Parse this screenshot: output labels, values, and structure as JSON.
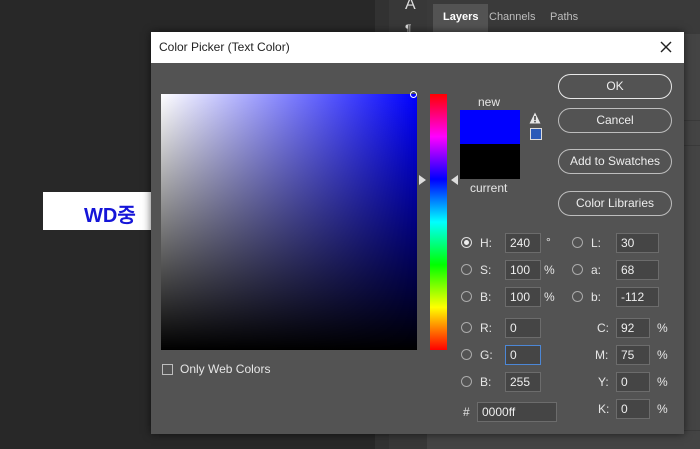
{
  "background": {
    "canvas_text": "WD중",
    "panel_tabs": [
      "Layers",
      "Channels",
      "Paths"
    ],
    "tool_glyph": "A",
    "tool_glyph2": "¶"
  },
  "dialog": {
    "title": "Color Picker (Text Color)",
    "close_icon": "close-icon",
    "new_label": "new",
    "current_label": "current",
    "new_color": "#0000ff",
    "current_color": "#000000",
    "only_web_colors_label": "Only Web Colors",
    "only_web_colors_checked": false,
    "buttons": {
      "ok": "OK",
      "cancel": "Cancel",
      "add_to_swatches": "Add to Swatches",
      "color_libraries": "Color Libraries"
    },
    "hsb": {
      "h_label": "H:",
      "h_value": "240",
      "h_unit": "°",
      "s_label": "S:",
      "s_value": "100",
      "s_unit": "%",
      "b_label": "B:",
      "b_value": "100",
      "b_unit": "%"
    },
    "rgb": {
      "r_label": "R:",
      "r_value": "0",
      "g_label": "G:",
      "g_value": "0",
      "b_label": "B:",
      "b_value": "255"
    },
    "lab": {
      "l_label": "L:",
      "l_value": "30",
      "a_label": "a:",
      "a_value": "68",
      "b_label": "b:",
      "b_value": "-112"
    },
    "cmyk": {
      "c_label": "C:",
      "c_value": "92",
      "c_unit": "%",
      "m_label": "M:",
      "m_value": "75",
      "m_unit": "%",
      "y_label": "Y:",
      "y_value": "0",
      "y_unit": "%",
      "k_label": "K:",
      "k_value": "0",
      "k_unit": "%"
    },
    "hex_label": "#",
    "hex_value": "0000ff",
    "selected_mode": "H"
  }
}
